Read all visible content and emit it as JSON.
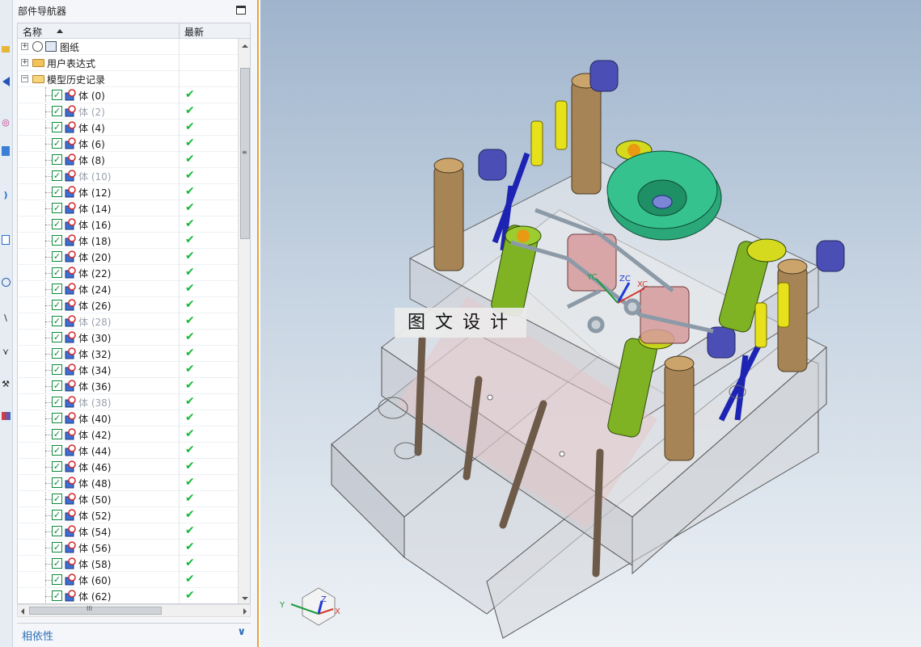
{
  "navigator": {
    "title": "部件导航器",
    "columns": {
      "name": "名称",
      "latest": "最新"
    },
    "nodes": {
      "drawing": "图纸",
      "user_expressions": "用户表达式",
      "model_history": "模型历史记录"
    },
    "bodies": [
      {
        "label": "体 (0)",
        "suppressed": false
      },
      {
        "label": "体 (2)",
        "suppressed": true
      },
      {
        "label": "体 (4)",
        "suppressed": false
      },
      {
        "label": "体 (6)",
        "suppressed": false
      },
      {
        "label": "体 (8)",
        "suppressed": false
      },
      {
        "label": "体 (10)",
        "suppressed": true
      },
      {
        "label": "体 (12)",
        "suppressed": false
      },
      {
        "label": "体 (14)",
        "suppressed": false
      },
      {
        "label": "体 (16)",
        "suppressed": false
      },
      {
        "label": "体 (18)",
        "suppressed": false
      },
      {
        "label": "体 (20)",
        "suppressed": false
      },
      {
        "label": "体 (22)",
        "suppressed": false
      },
      {
        "label": "体 (24)",
        "suppressed": false
      },
      {
        "label": "体 (26)",
        "suppressed": false
      },
      {
        "label": "体 (28)",
        "suppressed": true
      },
      {
        "label": "体 (30)",
        "suppressed": false
      },
      {
        "label": "体 (32)",
        "suppressed": false
      },
      {
        "label": "体 (34)",
        "suppressed": false
      },
      {
        "label": "体 (36)",
        "suppressed": false
      },
      {
        "label": "体 (38)",
        "suppressed": true
      },
      {
        "label": "体 (40)",
        "suppressed": false
      },
      {
        "label": "体 (42)",
        "suppressed": false
      },
      {
        "label": "体 (44)",
        "suppressed": false
      },
      {
        "label": "体 (46)",
        "suppressed": false
      },
      {
        "label": "体 (48)",
        "suppressed": false
      },
      {
        "label": "体 (50)",
        "suppressed": false
      },
      {
        "label": "体 (52)",
        "suppressed": false
      },
      {
        "label": "体 (54)",
        "suppressed": false
      },
      {
        "label": "体 (56)",
        "suppressed": false
      },
      {
        "label": "体 (58)",
        "suppressed": false
      },
      {
        "label": "体 (60)",
        "suppressed": false
      },
      {
        "label": "体 (62)",
        "suppressed": false
      }
    ],
    "latest_mark": "✔",
    "hscroll_mark": "III",
    "dependencies_label": "相依性"
  },
  "viewport": {
    "watermark": "图文设计",
    "triad_labels": {
      "x": "X",
      "y": "Y",
      "z": "Z"
    },
    "wcs_labels": {
      "x": "XC",
      "y": "YC",
      "z": "ZC"
    }
  },
  "colors": {
    "accent_border": "#e8a23a",
    "check_green": "#18b83a",
    "link_blue": "#2c6fb8",
    "suppressed_text": "#9aa2ad"
  }
}
